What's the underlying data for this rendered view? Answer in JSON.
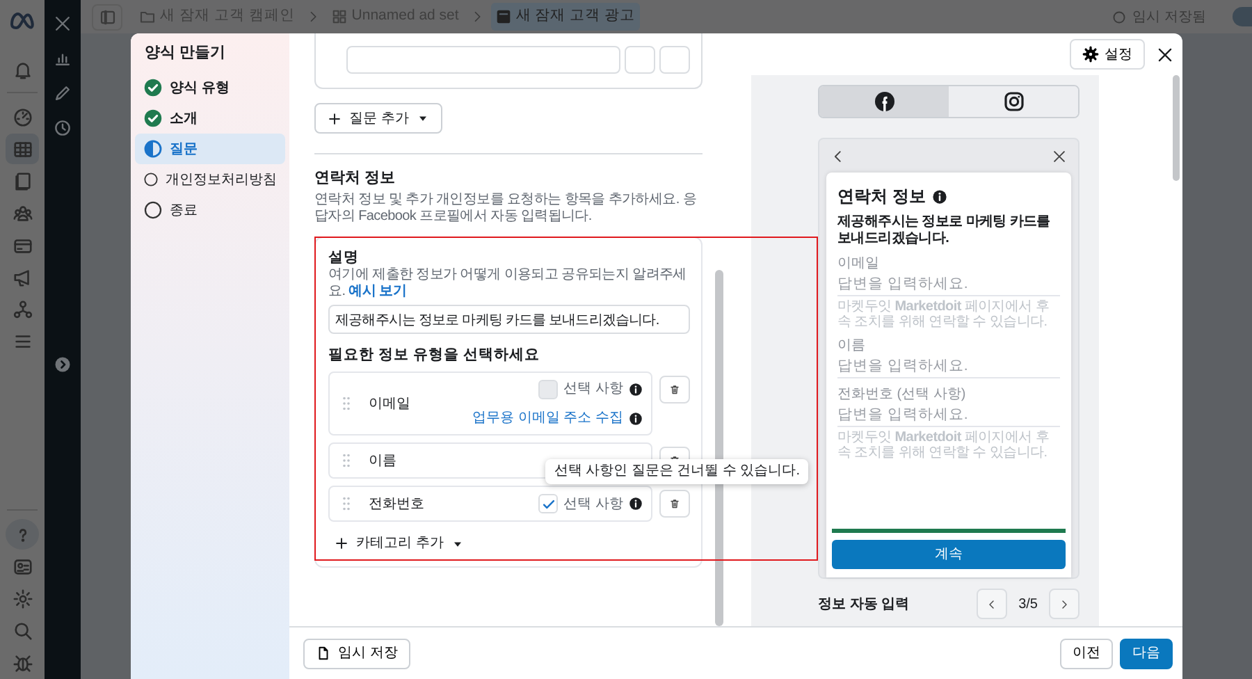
{
  "breadcrumb": [
    {
      "label": "새 잠재 고객 캠페인",
      "kind": "campaign",
      "selected": false
    },
    {
      "label": "Unnamed ad set",
      "kind": "adset",
      "selected": false
    },
    {
      "label": "새 잠재 고객 광고",
      "kind": "ad",
      "selected": true
    }
  ],
  "save_status": "임시 저장됨",
  "top_toggle": {
    "on": true
  },
  "nav_rail": [
    {
      "selected": false
    },
    {
      "selected": false
    },
    {
      "selected": true
    },
    {
      "selected": false
    },
    {
      "selected": false
    },
    {
      "selected": false
    },
    {
      "selected": false
    },
    {
      "selected": false
    },
    {
      "selected": false
    },
    {
      "selected": true
    },
    {
      "selected": false
    },
    {
      "selected": false
    },
    {
      "selected": false
    },
    {
      "selected": false
    }
  ],
  "form_steps": {
    "title": "양식 만들기",
    "steps": [
      {
        "label": "양식 유형",
        "completed": true,
        "selected": false
      },
      {
        "label": "소개",
        "completed": true,
        "selected": false
      },
      {
        "label": "질문",
        "completed": false,
        "selected": true
      },
      {
        "label": "개인정보처리방침",
        "completed": false,
        "selected": false
      },
      {
        "label": "종료",
        "completed": false,
        "selected": false
      }
    ]
  },
  "settings_button": "설정",
  "add_question_button": "질문 추가",
  "contact_section": {
    "title": "연락처 정보",
    "description": "연락처 정보 및 추가 개인정보를 요청하는 항목을 추가하세요. 응답자의 Facebook 프로필에서 자동 입력됩니다.",
    "description_label": "설명",
    "description_help": "여기에 제출한 정보가 어떻게 이용되고 공유되는지 알려주세요.",
    "example_link": "예시 보기",
    "description_value": "제공해주시는 정보로 마케팅 카드를 보내드리겠습니다.",
    "types_label": "필요한 정보 유형을 선택하세요",
    "fields": [
      {
        "label": "이메일",
        "optional_label": "선택 사항",
        "optional": false,
        "extra_link": "업무용 이메일 주소 수집"
      },
      {
        "label": "이름",
        "tooltip": "선택 사항인 질문은 건너뛸 수 있습니다."
      },
      {
        "label": "전화번호",
        "optional_label": "선택 사항",
        "optional": true
      }
    ],
    "add_category_button": "카테고리 추가"
  },
  "preview": {
    "tabs": [
      {
        "kind": "facebook",
        "selected": true
      },
      {
        "kind": "instagram",
        "selected": false
      }
    ],
    "form_title": "연락처 정보",
    "form_description": "제공해주시는 정보로 마케팅 카드를 보내드리겠습니다.",
    "questions": [
      {
        "label": "이메일",
        "placeholder": "답변을 입력하세요.",
        "note": "마켓두잇 **Marketdoit** 페이지에서 후속 조치를 위해 연락할 수 있습니다."
      },
      {
        "label": "이름",
        "placeholder": "답변을 입력하세요."
      },
      {
        "label": "전화번호 (선택 사항)",
        "placeholder": "답변을 입력하세요.",
        "note": "마켓두잇 **Marketdoit** 페이지에서 후속 조치를 위해 연락할 수 있습니다."
      }
    ],
    "progress": {
      "level": 1
    },
    "continue_button": "계속",
    "autofill_label": "정보 자동 입력",
    "pager": "3/5"
  },
  "footer": {
    "save_draft": "임시 저장",
    "back": "이전",
    "next": "다음"
  }
}
